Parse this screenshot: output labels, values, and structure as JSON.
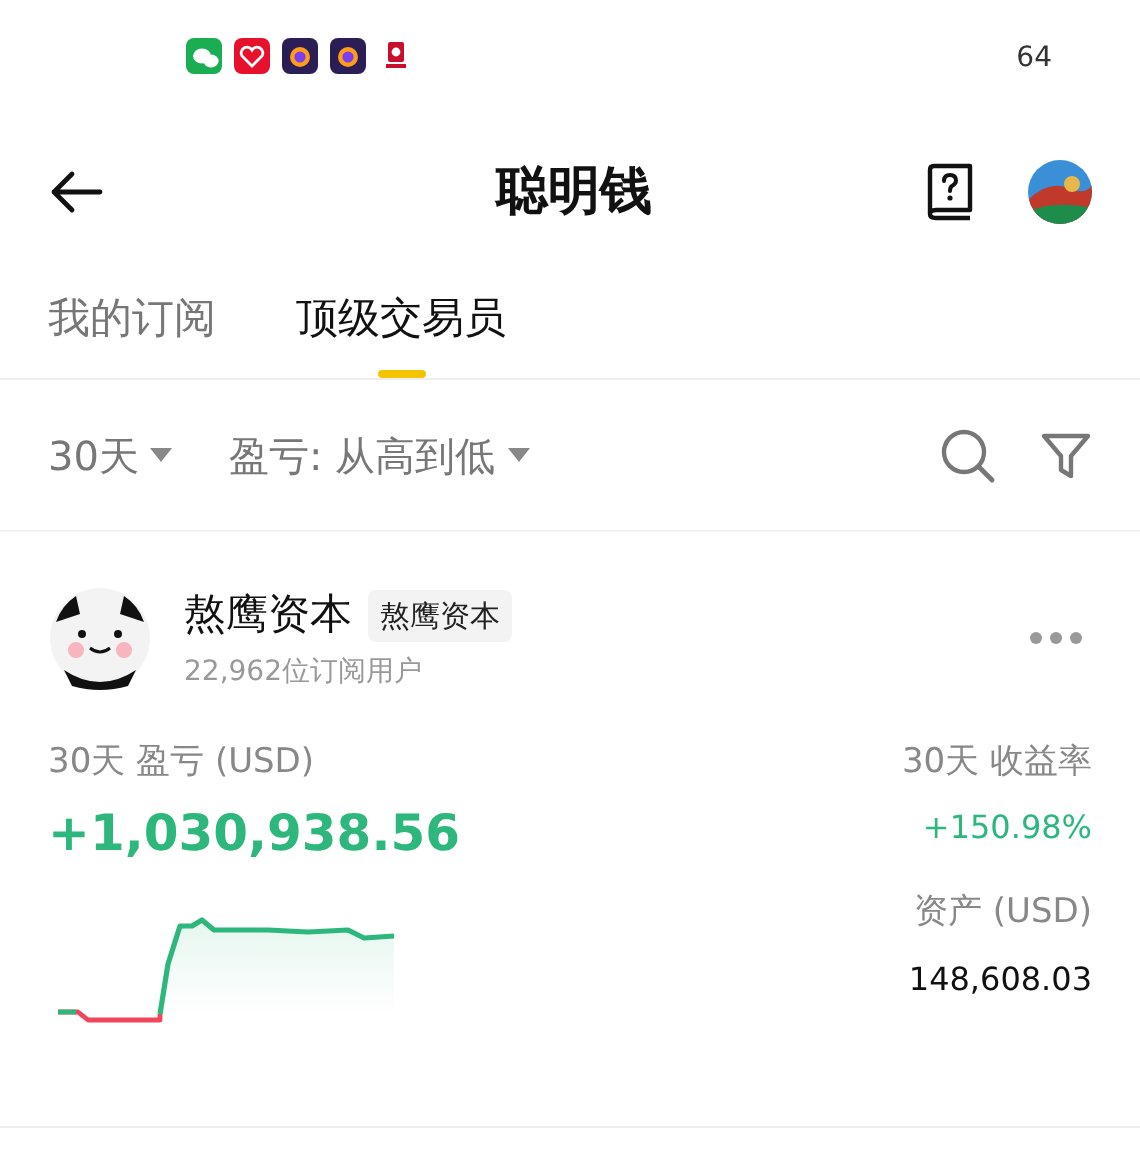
{
  "status_bar": {
    "notification_apps": [
      {
        "kind": "chat"
      },
      {
        "kind": "heart"
      },
      {
        "kind": "fox"
      },
      {
        "kind": "fox"
      },
      {
        "kind": "kfc"
      }
    ],
    "battery": "64"
  },
  "header": {
    "title": "聪明钱"
  },
  "tabs": [
    {
      "label": "我的订阅",
      "selected": false
    },
    {
      "label": "顶级交易员",
      "selected": true
    }
  ],
  "filters": [
    {
      "label": "30天"
    },
    {
      "label": "盈亏: 从高到低"
    }
  ],
  "trader": {
    "name": "熬鹰资本",
    "tag": "熬鹰资本",
    "subscribers": "22,962位订阅用户",
    "pnl_label": "30天 盈亏 (USD)",
    "pnl": "+1,030,938.56",
    "roi_label": "30天 收益率",
    "roi": "+150.98%",
    "assets_label": "资产 (USD)",
    "assets": "148,608.03"
  }
}
